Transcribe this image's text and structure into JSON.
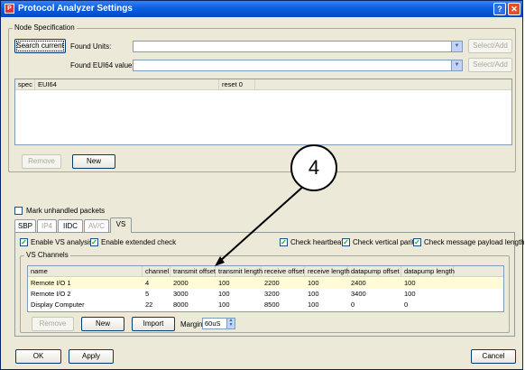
{
  "window": {
    "title": "Protocol Analyzer Settings",
    "help_glyph": "?",
    "close_glyph": "✕"
  },
  "node_spec": {
    "legend": "Node Specification",
    "search_button": "Search current",
    "found_units_label": "Found Units:",
    "found_units_value": "",
    "found_eui_label": "Found EUI64 values:",
    "found_eui_value": "",
    "select_add_1": "Select/Add",
    "select_add_2": "Select/Add",
    "columns": [
      "spec",
      "EUI64",
      "reset 0"
    ],
    "remove_button": "Remove",
    "new_button": "New"
  },
  "mark_unhandled": {
    "label": "Mark unhandled packets",
    "checked": false
  },
  "tabs": [
    {
      "label": "SBP",
      "disabled": false,
      "active": false
    },
    {
      "label": "IP4",
      "disabled": true,
      "active": false
    },
    {
      "label": "IIDC",
      "disabled": false,
      "active": false
    },
    {
      "label": "AV/C",
      "disabled": true,
      "active": false
    },
    {
      "label": "VS",
      "disabled": false,
      "active": true
    }
  ],
  "vs": {
    "enable_analysis": "Enable VS analysis",
    "enable_extended": "Enable extended check",
    "check_heartbeat": "Check heartbeat",
    "check_parity": "Check vertical parity",
    "check_payload": "Check message payload length",
    "channels_legend": "VS Channels",
    "columns": [
      "name",
      "channel",
      "transmit offset",
      "transmit length",
      "receive offset",
      "receive length",
      "datapump offset",
      "datapump length"
    ],
    "rows": [
      [
        "Remote I/O 1",
        "4",
        "2000",
        "100",
        "2200",
        "100",
        "2400",
        "100"
      ],
      [
        "Remote I/O 2",
        "5",
        "3000",
        "100",
        "3200",
        "100",
        "3400",
        "100"
      ],
      [
        "Display Computer",
        "22",
        "8000",
        "100",
        "8500",
        "100",
        "0",
        "0"
      ]
    ],
    "remove_button": "Remove",
    "new_button": "New",
    "import_button": "Import",
    "margin_label": "Margin",
    "margin_value": "60uS"
  },
  "footer": {
    "ok_button": "OK",
    "apply_button": "Apply",
    "cancel_button": "Cancel"
  },
  "callout": {
    "number": "4"
  },
  "colors": {
    "title_bar": "#0a5fe0",
    "dialog_bg": "#ece9d8",
    "selected_row": "#fffbd6",
    "check_mark": "#21a121"
  }
}
